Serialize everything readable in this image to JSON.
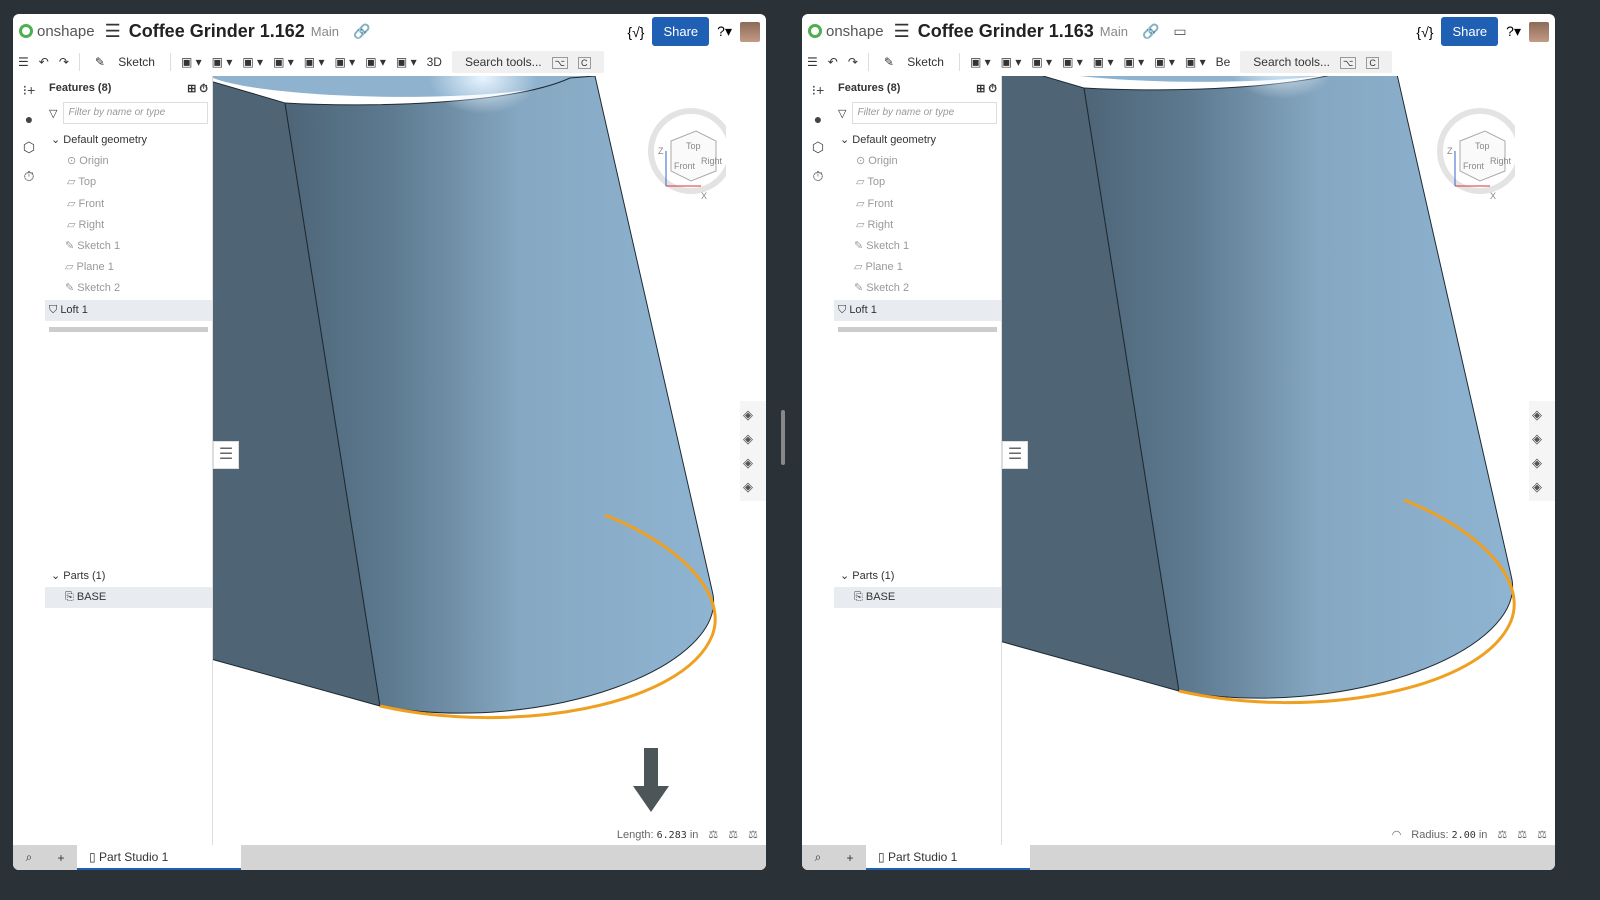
{
  "windows": [
    {
      "logo": "onshape",
      "title": "Coffee Grinder 1.162",
      "branch": "Main",
      "share": "Share",
      "view_mode": "3D",
      "search": "Search tools...",
      "kbd1": "⌥",
      "kbd2": "C",
      "sketch": "Sketch",
      "features_header": "Features (8)",
      "filter_placeholder": "Filter by name or type",
      "tree": [
        "Default geometry",
        "Origin",
        "Top",
        "Front",
        "Right",
        "Sketch 1",
        "Plane 1",
        "Sketch 2",
        "Loft 1"
      ],
      "parts_header": "Parts (1)",
      "part": "BASE",
      "status_label": "Length:",
      "status_value": "6.283",
      "status_unit": "in",
      "tab": "Part Studio 1",
      "cube": [
        "Top",
        "Front",
        "Right",
        "Z",
        "X"
      ]
    },
    {
      "logo": "onshape",
      "title": "Coffee Grinder 1.163",
      "branch": "Main",
      "share": "Share",
      "view_mode": "Be",
      "search": "Search tools...",
      "kbd1": "⌥",
      "kbd2": "C",
      "sketch": "Sketch",
      "features_header": "Features (8)",
      "filter_placeholder": "Filter by name or type",
      "tree": [
        "Default geometry",
        "Origin",
        "Top",
        "Front",
        "Right",
        "Sketch 1",
        "Plane 1",
        "Sketch 2",
        "Loft 1"
      ],
      "parts_header": "Parts (1)",
      "part": "BASE",
      "status_label": "Radius:",
      "status_value": "2.00",
      "status_unit": "in",
      "tab": "Part Studio 1",
      "cube": [
        "Top",
        "Front",
        "Right",
        "Z",
        "X"
      ]
    }
  ],
  "colors": {
    "accent": "#1f5fb4",
    "selection": "#f5a623",
    "model": "#8fb3cf"
  }
}
